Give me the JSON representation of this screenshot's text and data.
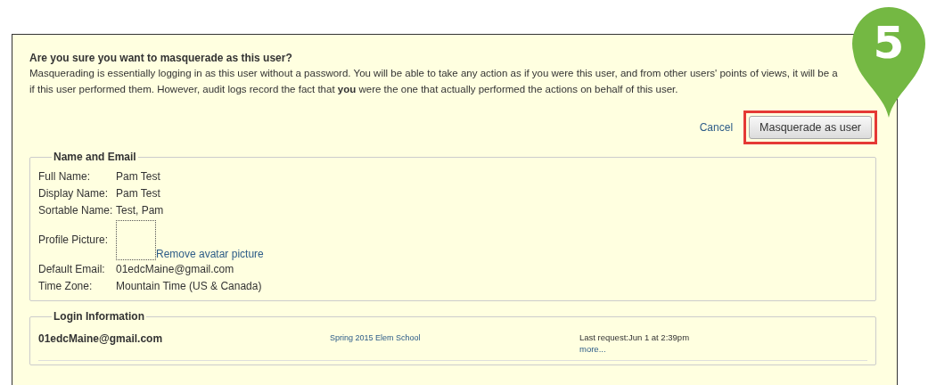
{
  "dialog": {
    "question": "Are you sure you want to masquerade as this user?",
    "explanation_lines": [
      "Masquerading is essentially logging in as this user without a password. You will be able to take any action as if you were this user, and from other users' points of views, it will be a",
      "if this user performed them. However, audit logs record the fact that **you** were the one that actually performed the actions on behalf of this user."
    ],
    "cancel": "Cancel",
    "confirm": "Masquerade as user"
  },
  "step_marker": "5",
  "name_and_email": {
    "legend": "Name and Email",
    "fields": [
      {
        "kind": "text",
        "label": "Full Name:",
        "value": "Pam Test"
      },
      {
        "kind": "text",
        "label": "Display Name:",
        "value": "Pam Test"
      },
      {
        "kind": "text",
        "label": "Sortable Name:",
        "value": "Test, Pam"
      },
      {
        "kind": "avatar",
        "label": "Profile Picture:",
        "value": "Remove avatar picture"
      },
      {
        "kind": "text",
        "label": "Default Email:",
        "value": "01edcMaine@gmail.com"
      },
      {
        "kind": "text",
        "label": "Time Zone:",
        "value": "Mountain Time (US & Canada)"
      }
    ]
  },
  "login_information": {
    "legend": "Login Information",
    "login": "01edcMaine@gmail.com",
    "account": "Spring 2015 Elem School",
    "last_request": "Last request:Jun 1 at 2:39pm",
    "more": "more..."
  }
}
